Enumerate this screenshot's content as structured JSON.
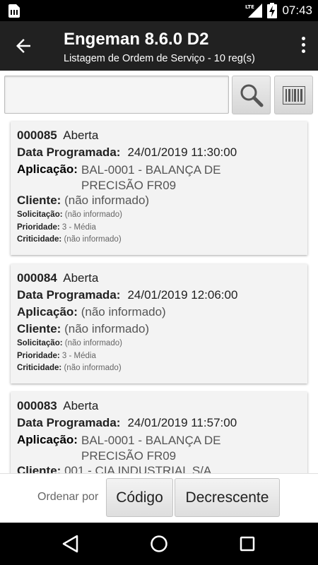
{
  "status_bar": {
    "time": "07:43",
    "network": "LTE",
    "icons": [
      "sim-card-icon",
      "lte-signal-icon",
      "battery-charging-icon"
    ]
  },
  "app_bar": {
    "title": "Engeman 8.6.0 D2",
    "subtitle": "Listagem de Ordem de Serviço - 10 reg(s)",
    "icons": [
      "back-arrow-icon",
      "overflow-menu-icon"
    ]
  },
  "search": {
    "value": "",
    "placeholder": "",
    "icons": [
      "search-icon",
      "barcode-icon"
    ]
  },
  "orders": [
    {
      "code": "000085",
      "status": "Aberta",
      "data_label": "Data Programada:",
      "data_value": "24/01/2019 11:30:00",
      "aplicacao_label": "Aplicação:",
      "aplicacao_value": "BAL-0001 - BALANÇA DE PRECISÃO FR09",
      "cliente_label": "Cliente:",
      "cliente_value": "(não informado)",
      "solicitacao_label": "Solicitação:",
      "solicitacao_value": "(não informado)",
      "prioridade_label": "Prioridade:",
      "prioridade_value": "3 - Média",
      "criticidade_label": "Criticidade:",
      "criticidade_value": "(não informado)"
    },
    {
      "code": "000084",
      "status": "Aberta",
      "data_label": "Data Programada:",
      "data_value": "24/01/2019 12:06:00",
      "aplicacao_label": "Aplicação:",
      "aplicacao_value": "(não informado)",
      "cliente_label": "Cliente:",
      "cliente_value": "(não informado)",
      "solicitacao_label": "Solicitação:",
      "solicitacao_value": "(não informado)",
      "prioridade_label": "Prioridade:",
      "prioridade_value": "3 - Média",
      "criticidade_label": "Criticidade:",
      "criticidade_value": "(não informado)"
    },
    {
      "code": "000083",
      "status": "Aberta",
      "data_label": "Data Programada:",
      "data_value": "24/01/2019 11:57:00",
      "aplicacao_label": "Aplicação:",
      "aplicacao_value": "BAL-0001 - BALANÇA DE PRECISÃO FR09",
      "cliente_label": "Cliente:",
      "cliente_value": "001 - CIA INDUSTRIAL S/A"
    }
  ],
  "sort": {
    "label": "Ordenar por",
    "field": "Código",
    "order": "Decrescente"
  },
  "nav_bar": {
    "icons": [
      "back-triangle-icon",
      "home-circle-icon",
      "recents-square-icon"
    ]
  }
}
